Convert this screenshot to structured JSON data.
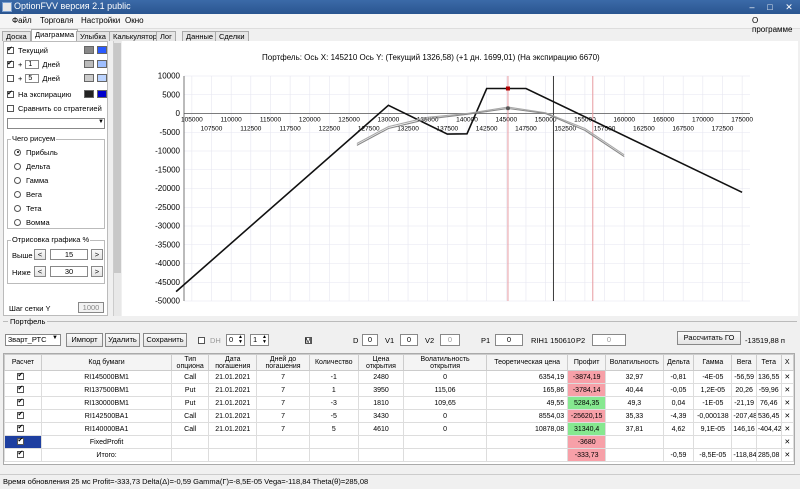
{
  "window": {
    "title": "OptionFVV версия 2.1 public"
  },
  "menu": {
    "items": [
      "Файл",
      "Торговля",
      "Настройки",
      "Окно"
    ],
    "about": "О программе"
  },
  "tabs": [
    "Доска",
    "Диаграмма",
    "Улыбка",
    "Калькулятор",
    "Лог",
    "Данные",
    "Сделки"
  ],
  "left": {
    "current_label": "Текущий",
    "plus": "+",
    "days_label": "Дней",
    "days1": "1",
    "days2": "5",
    "expiration_label": "На экспирацию",
    "compare_label": "Сравнить со стратегией",
    "draw_group": "Чего рисуем",
    "draw_options": [
      "Прибыль",
      "Дельта",
      "Гамма",
      "Вега",
      "Тета",
      "Вомма"
    ],
    "render_group": "Отрисовка графика %",
    "above_label": "Выше",
    "above_value": "15",
    "below_label": "Ниже",
    "below_value": "30",
    "grid_step_label": "Шаг сетки Y",
    "grid_step_value": "1000",
    "colors": {
      "current": [
        "#888888",
        "#2a5aff"
      ],
      "plus1": [
        "#bbbbbb",
        "#9fbfff"
      ],
      "plus5": [
        "#cccccc",
        "#bcd4ff"
      ],
      "expiration": [
        "#222222",
        "#0000cc"
      ]
    }
  },
  "chart_data": {
    "type": "line",
    "title": "Портфель: Ось X: 145210 Ось Y:  (Текущий 1326,58)  (+1 дн. 1699,01)  (На экспирацию 6670)",
    "x_ticks_top": [
      "105000",
      "110000",
      "115000",
      "120000",
      "125000",
      "130000",
      "135000",
      "140000",
      "145000",
      "150000",
      "155000",
      "160000",
      "165000",
      "170000",
      "175000"
    ],
    "x_ticks_bottom": [
      "107500",
      "112500",
      "117500",
      "122500",
      "127500",
      "132500",
      "137500",
      "142500",
      "147500",
      "152500",
      "157500",
      "162500",
      "167500",
      "172500"
    ],
    "y_ticks": [
      "10000",
      "5000",
      "0",
      "-5000",
      "-10000",
      "-15000",
      "-20000",
      "-25000",
      "-30000",
      "-35000",
      "-40000",
      "-45000",
      "-50000"
    ],
    "xlim": [
      104000,
      176000
    ],
    "ylim": [
      -50000,
      10000
    ],
    "vlines": [
      {
        "x": 145210,
        "color": "#e89aa0"
      },
      {
        "x": 151000,
        "color": "#3a3a3a"
      },
      {
        "x": 156000,
        "color": "#e89aa0"
      }
    ],
    "series": [
      {
        "color": "#111111",
        "x": [
          103000,
          130000,
          137500,
          140000,
          142500,
          147500,
          175000
        ],
        "y": [
          -47500,
          2200,
          -5500,
          -5400,
          6670,
          6670,
          -21000
        ]
      },
      {
        "color": "#a8a8a8",
        "x": [
          126000,
          130000,
          135000,
          140000,
          145210,
          150000,
          155000,
          160000
        ],
        "y": [
          -8000,
          -3500,
          -1000,
          0,
          1699,
          200,
          -4000,
          -11000
        ]
      },
      {
        "color": "#888888",
        "x": [
          126000,
          130000,
          135000,
          140000,
          145210,
          150000,
          155000,
          160000
        ],
        "y": [
          -8500,
          -4000,
          -1500,
          -200,
          1326,
          0,
          -4500,
          -11500
        ]
      }
    ],
    "point": {
      "x": 145210,
      "y": 6670
    }
  },
  "controls": {
    "portfolio_label": "Портфель",
    "portfolio_select": "3варт_РТС",
    "import": "Импорт",
    "delete": "Удалить",
    "save": "Сохранить",
    "dh_label": "DH",
    "dh1": "0",
    "dh2": "1",
    "m_label": "M",
    "d_label": "D",
    "d_value": "0",
    "v1_label": "V1",
    "v1_value": "0",
    "v2_label": "V2",
    "v2_value": "0",
    "p1_label": "P1",
    "p1_value": "0",
    "ri_label": "RIH1 150610",
    "p2_label": "P2",
    "p2_value": "0",
    "calc_go": "Рассчитать ГО",
    "go_value": "-13519,88 п"
  },
  "table": {
    "headers": [
      "Расчет",
      "Код бумаги",
      "Тип опциона",
      "Дата погашения",
      "Дней до погашения",
      "Количество",
      "Цена открытия",
      "Волатильность открытия",
      "Теоретическая цена",
      "Профит",
      "Волатильность",
      "Дельта",
      "Гамма",
      "Вега",
      "Тета",
      "X"
    ],
    "rows": [
      {
        "code": "RI145000BM1",
        "type": "Call",
        "date": "21.01.2021",
        "days": "7",
        "qty": "-1",
        "price": "2480",
        "vol_open": "0",
        "theo": "6354,19",
        "profit": "-3874,19",
        "profit_color": "red",
        "vol": "32,97",
        "delta": "-0,81",
        "gamma": "-4E-05",
        "vega": "-56,59",
        "theta": "136,55"
      },
      {
        "code": "RI137500BM1",
        "type": "Put",
        "date": "21.01.2021",
        "days": "7",
        "qty": "1",
        "price": "3950",
        "vol_open": "115,06",
        "theo": "165,86",
        "profit": "-3784,14",
        "profit_color": "red",
        "vol": "40,44",
        "delta": "-0,05",
        "gamma": "1,2E-05",
        "vega": "20,26",
        "theta": "-59,96"
      },
      {
        "code": "RI130000BM1",
        "type": "Put",
        "date": "21.01.2021",
        "days": "7",
        "qty": "-3",
        "price": "1810",
        "vol_open": "109,65",
        "theo": "49,55",
        "profit": "5284,35",
        "profit_color": "green",
        "vol": "49,3",
        "delta": "0,04",
        "gamma": "-1E-05",
        "vega": "-21,19",
        "theta": "76,46"
      },
      {
        "code": "RI142500BA1",
        "type": "Call",
        "date": "21.01.2021",
        "days": "7",
        "qty": "-5",
        "price": "3430",
        "vol_open": "0",
        "theo": "8554,03",
        "profit": "-25620,15",
        "profit_color": "red",
        "vol": "35,33",
        "delta": "-4,39",
        "gamma": "-0,000138",
        "vega": "-207,48",
        "theta": "536,45"
      },
      {
        "code": "RI140000BA1",
        "type": "Call",
        "date": "21.01.2021",
        "days": "7",
        "qty": "5",
        "price": "4610",
        "vol_open": "0",
        "theo": "10878,08",
        "profit": "31340,4",
        "profit_color": "green",
        "vol": "37,81",
        "delta": "4,62",
        "gamma": "9,1E-05",
        "vega": "146,16",
        "theta": "-404,42"
      }
    ],
    "fixed_label": "FixedProfit",
    "fixed_value": "-3680",
    "total_label": "Итого:",
    "total": {
      "profit": "-333,73",
      "delta": "-0,59",
      "gamma": "-8,5E-05",
      "vega": "-118,84",
      "theta": "285,08"
    },
    "x_glyph": "✕"
  },
  "status": "Время обновления 25 мс  Profit=-333,73 Delta(Δ)=-0,59 Gamma(Γ)=-8,5E-05 Vega=-118,84 Theta(θ)=285,08"
}
